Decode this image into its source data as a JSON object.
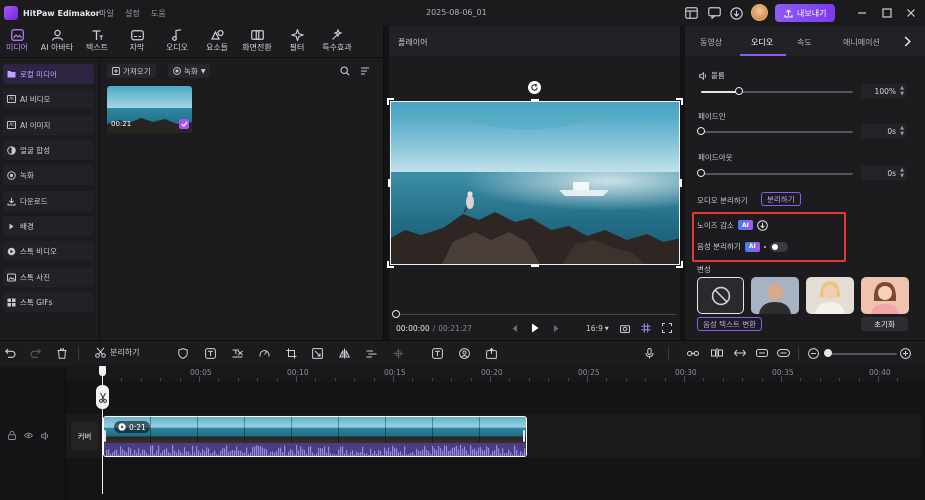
{
  "app": {
    "name": "HitPaw Edimakor",
    "menu": [
      "파일",
      "설정",
      "도움"
    ],
    "project_title": "2025-08-06_01",
    "export_label": "내보내기"
  },
  "toolbar": {
    "items": [
      {
        "label": "미디어",
        "icon": "media-icon",
        "active": true
      },
      {
        "label": "AI 아바타",
        "icon": "avatar-icon",
        "active": false
      },
      {
        "label": "텍스트",
        "icon": "text-icon",
        "active": false
      },
      {
        "label": "자막",
        "icon": "subtitle-icon",
        "active": false
      },
      {
        "label": "오디오",
        "icon": "music-icon",
        "active": false
      },
      {
        "label": "요소들",
        "icon": "elements-icon",
        "active": false
      },
      {
        "label": "화면전환",
        "icon": "transition-icon",
        "active": false
      },
      {
        "label": "필터",
        "icon": "filter-icon",
        "active": false
      },
      {
        "label": "특수효과",
        "icon": "effects-icon",
        "active": false
      }
    ]
  },
  "sidebar": {
    "items": [
      {
        "label": "로컬 미디어",
        "icon": "folder-icon",
        "active": true
      },
      {
        "label": "AI 비디오",
        "icon": "ai-video-icon",
        "active": false
      },
      {
        "label": "AI 이미지",
        "icon": "ai-image-icon",
        "active": false
      },
      {
        "label": "얼굴 합성",
        "icon": "face-swap-icon",
        "active": false
      },
      {
        "label": "녹화",
        "icon": "record-icon",
        "active": false
      },
      {
        "label": "다운로드",
        "icon": "download-icon",
        "active": false
      },
      {
        "label": "배경",
        "icon": "background-icon",
        "active": false
      },
      {
        "label": "스톡 비디오",
        "icon": "stock-video-icon",
        "active": false
      },
      {
        "label": "스톡 사진",
        "icon": "stock-photo-icon",
        "active": false
      },
      {
        "label": "스톡 GIFs",
        "icon": "gif-icon",
        "active": false
      }
    ]
  },
  "media": {
    "import_label": "가져오기",
    "record_label": "녹화",
    "clip_duration": "00:21"
  },
  "player": {
    "title": "플레이어",
    "current_time": "00:00:00",
    "total_time": "00:21:27",
    "aspect_ratio": "16:9"
  },
  "right_panel": {
    "tabs": [
      "동영상",
      "오디오",
      "속도",
      "애니메이션"
    ],
    "active_tab": "오디오",
    "volume_label": "볼륨",
    "volume_value": "100%",
    "volume_level": 0.25,
    "fade_in_label": "페이드인",
    "fade_in_value": "0s",
    "fade_out_label": "페이드아웃",
    "fade_out_value": "0s",
    "audio_split_label": "오디오 분리하기",
    "split_button": "분리하기",
    "noise_label": "노이즈 감소",
    "voice_split_label": "음성 분리하기",
    "ai_badge": "AI",
    "voice_change_label": "변성",
    "voice_text_button": "음성 텍스트 변환",
    "reset_button": "초기화",
    "highlight_color": "#e53935",
    "accent_color": "#8b5cf6"
  },
  "timeline": {
    "split_label": "분리하기",
    "ticks": [
      "00:05",
      "00:10",
      "00:15",
      "00:20",
      "00:25",
      "00:30",
      "00:35",
      "00:40"
    ],
    "clip_duration": "0:21",
    "cover_label": "커버"
  }
}
